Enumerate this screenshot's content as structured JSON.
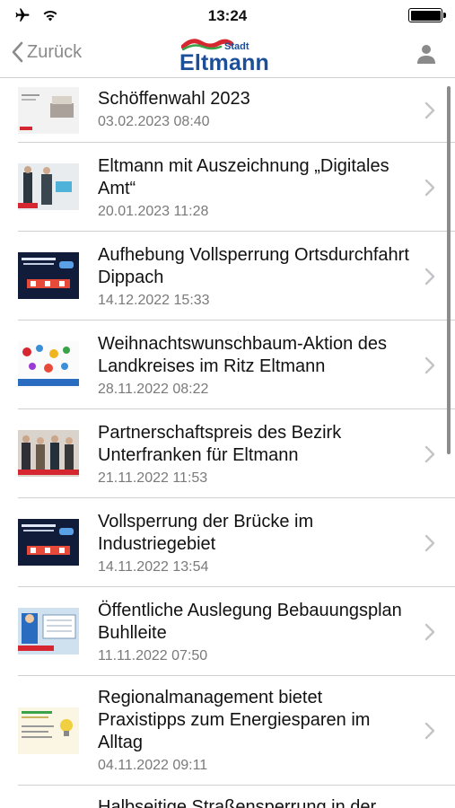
{
  "status_bar": {
    "time": "13:24"
  },
  "nav": {
    "back_label": "Zurück",
    "logo_small": "Stadt",
    "logo_name": "Eltmann"
  },
  "news": [
    {
      "title": "Schöffenwahl 2023",
      "date": "03.02.2023 08:40"
    },
    {
      "title": "Eltmann mit Auszeichnung „Digitales Amt“",
      "date": "20.01.2023 11:28"
    },
    {
      "title": "Aufhebung Vollsperrung Ortsdurchfahrt Dippach",
      "date": "14.12.2022 15:33"
    },
    {
      "title": "Weihnachtswunschbaum-Aktion des Landkreises im Ritz Eltmann",
      "date": "28.11.2022 08:22"
    },
    {
      "title": "Partnerschaftspreis des Bezirk Unterfranken für Eltmann",
      "date": "21.11.2022 11:53"
    },
    {
      "title": "Vollsperrung der Brücke im Industriegebiet",
      "date": "14.11.2022 13:54"
    },
    {
      "title": "Öffentliche Auslegung Bebauungsplan Buhlleite",
      "date": "11.11.2022 07:50"
    },
    {
      "title": "Regionalmanagement bietet Praxistipps zum Energiesparen im Alltag",
      "date": "04.11.2022 09:11"
    },
    {
      "title": "Halbseitige Straßensperrung in der",
      "date": ""
    }
  ],
  "colors": {
    "brand_blue": "#1c4f98",
    "logo_red": "#d6262f",
    "logo_green": "#3aa34a",
    "chevron": "#c4c4c8",
    "date_gray": "#7a7a7a"
  }
}
